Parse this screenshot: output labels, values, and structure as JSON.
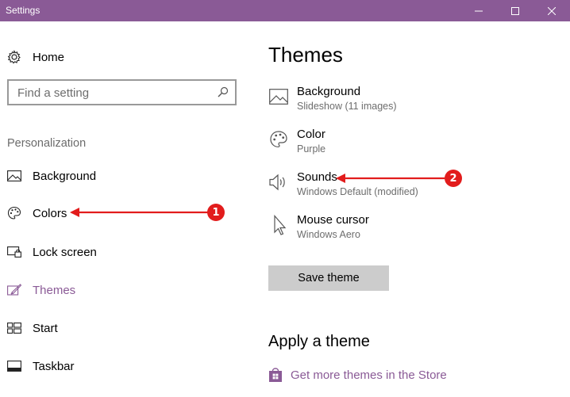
{
  "window": {
    "title": "Settings",
    "controls": [
      "minimize",
      "maximize",
      "close"
    ]
  },
  "colors": {
    "accent": "#8a5a96",
    "annotation": "#e21c1c"
  },
  "sidebar": {
    "home": {
      "label": "Home",
      "icon": "gear-icon"
    },
    "search": {
      "placeholder": "Find a setting",
      "icon": "search-icon"
    },
    "section_label": "Personalization",
    "items": [
      {
        "label": "Background",
        "icon": "picture-icon"
      },
      {
        "label": "Colors",
        "icon": "palette-icon"
      },
      {
        "label": "Lock screen",
        "icon": "lock-screen-icon"
      },
      {
        "label": "Themes",
        "icon": "paintbrush-icon",
        "active": true
      },
      {
        "label": "Start",
        "icon": "start-grid-icon"
      },
      {
        "label": "Taskbar",
        "icon": "taskbar-icon"
      }
    ]
  },
  "main": {
    "title": "Themes",
    "theme_items": [
      {
        "name": "Background",
        "value": "Slideshow (11 images)",
        "icon": "picture-icon"
      },
      {
        "name": "Color",
        "value": "Purple",
        "icon": "palette-icon"
      },
      {
        "name": "Sounds",
        "value": "Windows Default (modified)",
        "icon": "speaker-icon"
      },
      {
        "name": "Mouse cursor",
        "value": "Windows Aero",
        "icon": "cursor-icon"
      }
    ],
    "save_button": "Save theme",
    "apply_heading": "Apply a theme",
    "store_link": "Get more themes in the Store"
  },
  "annotations": [
    {
      "number": "1",
      "target": "Colors"
    },
    {
      "number": "2",
      "target": "Sounds"
    }
  ]
}
